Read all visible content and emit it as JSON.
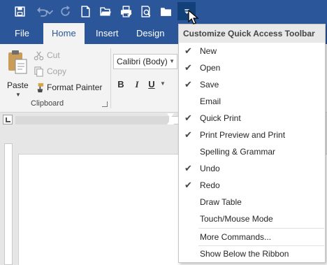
{
  "qat": {
    "icons": [
      "save-icon",
      "undo-icon",
      "redo-icon",
      "new-document-icon",
      "open-folder-icon",
      "print-preview-icon",
      "print-icon",
      "folder-icon",
      "customize-caret-icon"
    ]
  },
  "tabs": [
    "File",
    "Home",
    "Insert",
    "Design"
  ],
  "ribbon": {
    "clipboard": {
      "paste": "Paste",
      "cut": "Cut",
      "copy": "Copy",
      "format_painter": "Format Painter",
      "group_label": "Clipboard"
    },
    "font": {
      "name": "Calibri (Body)",
      "bold": "B",
      "italic": "I",
      "underline": "U"
    }
  },
  "menu": {
    "title": "Customize Quick Access Toolbar",
    "items": [
      {
        "label": "New",
        "checked": true
      },
      {
        "label": "Open",
        "checked": true
      },
      {
        "label": "Save",
        "checked": true
      },
      {
        "label": "Email",
        "checked": false
      },
      {
        "label": "Quick Print",
        "checked": true
      },
      {
        "label": "Print Preview and Print",
        "checked": true
      },
      {
        "label": "Spelling & Grammar",
        "checked": false
      },
      {
        "label": "Undo",
        "checked": true
      },
      {
        "label": "Redo",
        "checked": true
      },
      {
        "label": "Draw Table",
        "checked": false
      },
      {
        "label": "Touch/Mouse Mode",
        "checked": false
      }
    ],
    "more_commands": "More Commands...",
    "show_below": "Show Below the Ribbon",
    "check_glyph": "✔"
  },
  "colors": {
    "brand": "#2b579a",
    "ribbon_bg": "#f3f3f3",
    "menu_header_bg": "#e8e8e8"
  }
}
